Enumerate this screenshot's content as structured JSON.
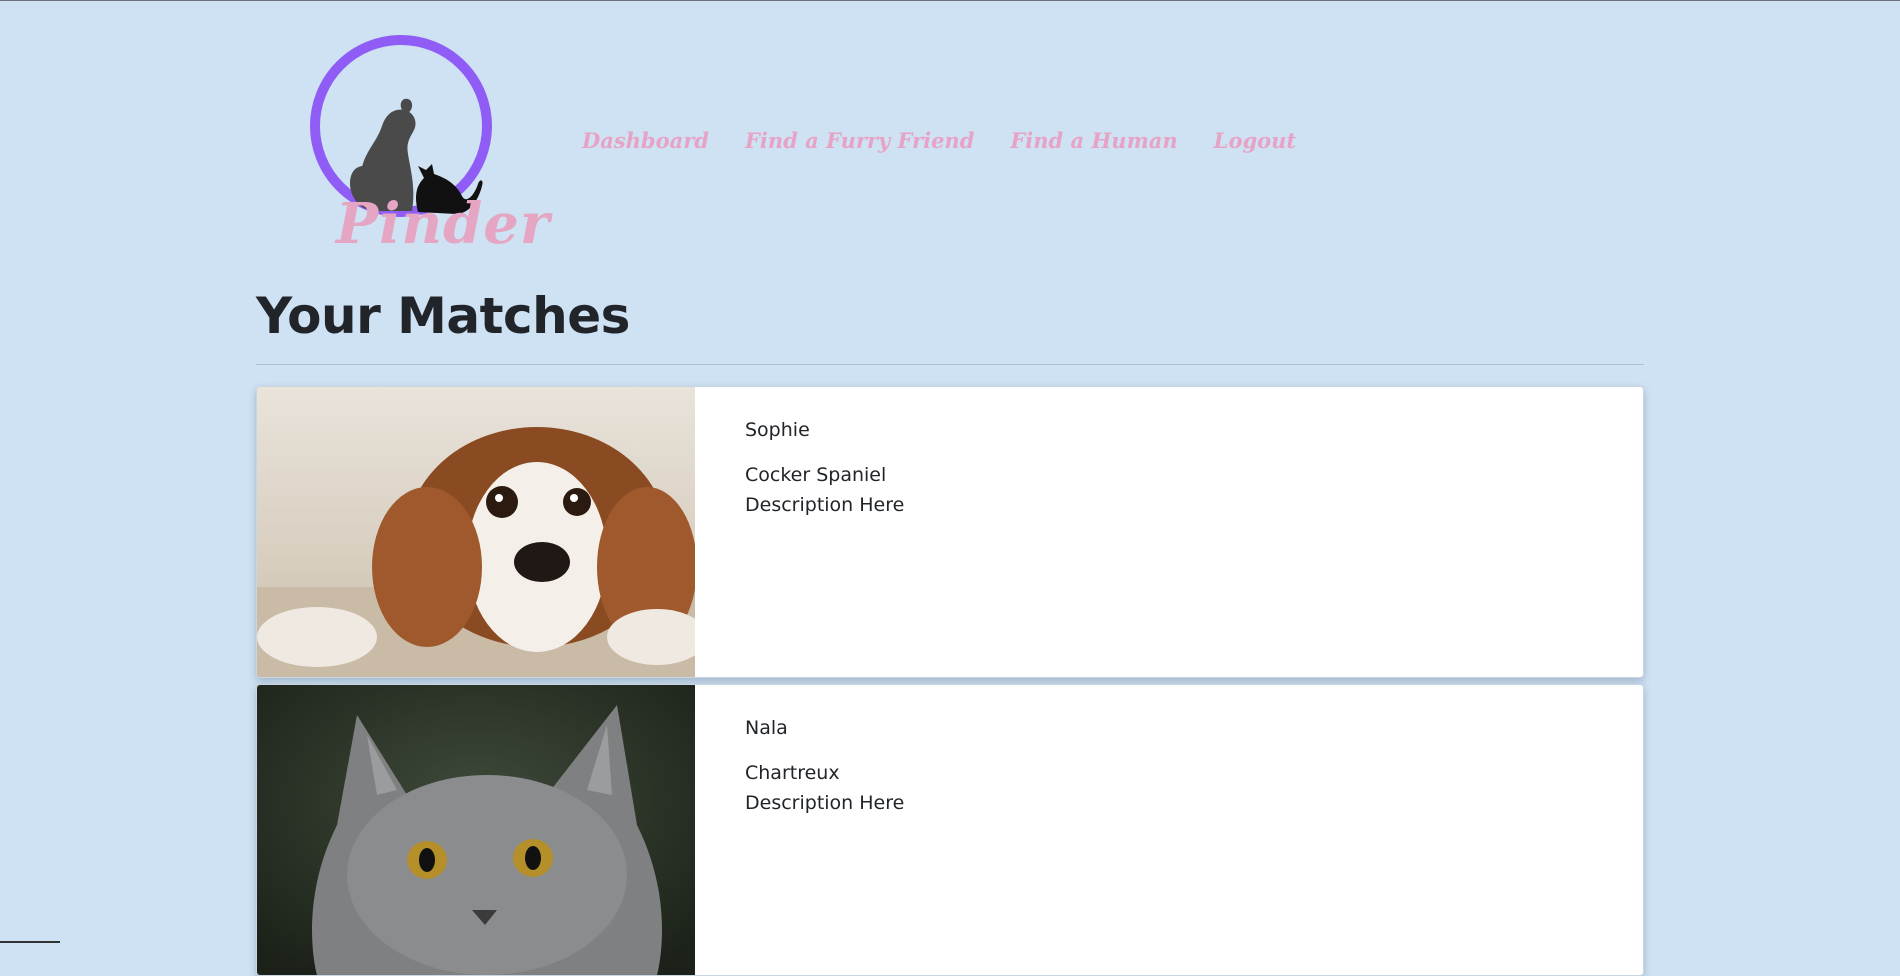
{
  "brand": {
    "logo_text": "Pinder"
  },
  "nav": {
    "items": [
      {
        "label": "Dashboard"
      },
      {
        "label": "Find a Furry Friend"
      },
      {
        "label": "Find a Human"
      },
      {
        "label": "Logout"
      }
    ]
  },
  "page": {
    "title": "Your Matches"
  },
  "matches": [
    {
      "name": "Sophie",
      "breed": "Cocker Spaniel",
      "description": "Description Here",
      "photo": "dog-photo"
    },
    {
      "name": "Nala",
      "breed": "Chartreux",
      "description": "Description Here",
      "photo": "cat-photo"
    }
  ],
  "colors": {
    "background": "#cfe2f3",
    "nav_link": "#e7a3c5",
    "logo_ring": "#8f5cf5",
    "logo_text": "#e5a6c3"
  }
}
